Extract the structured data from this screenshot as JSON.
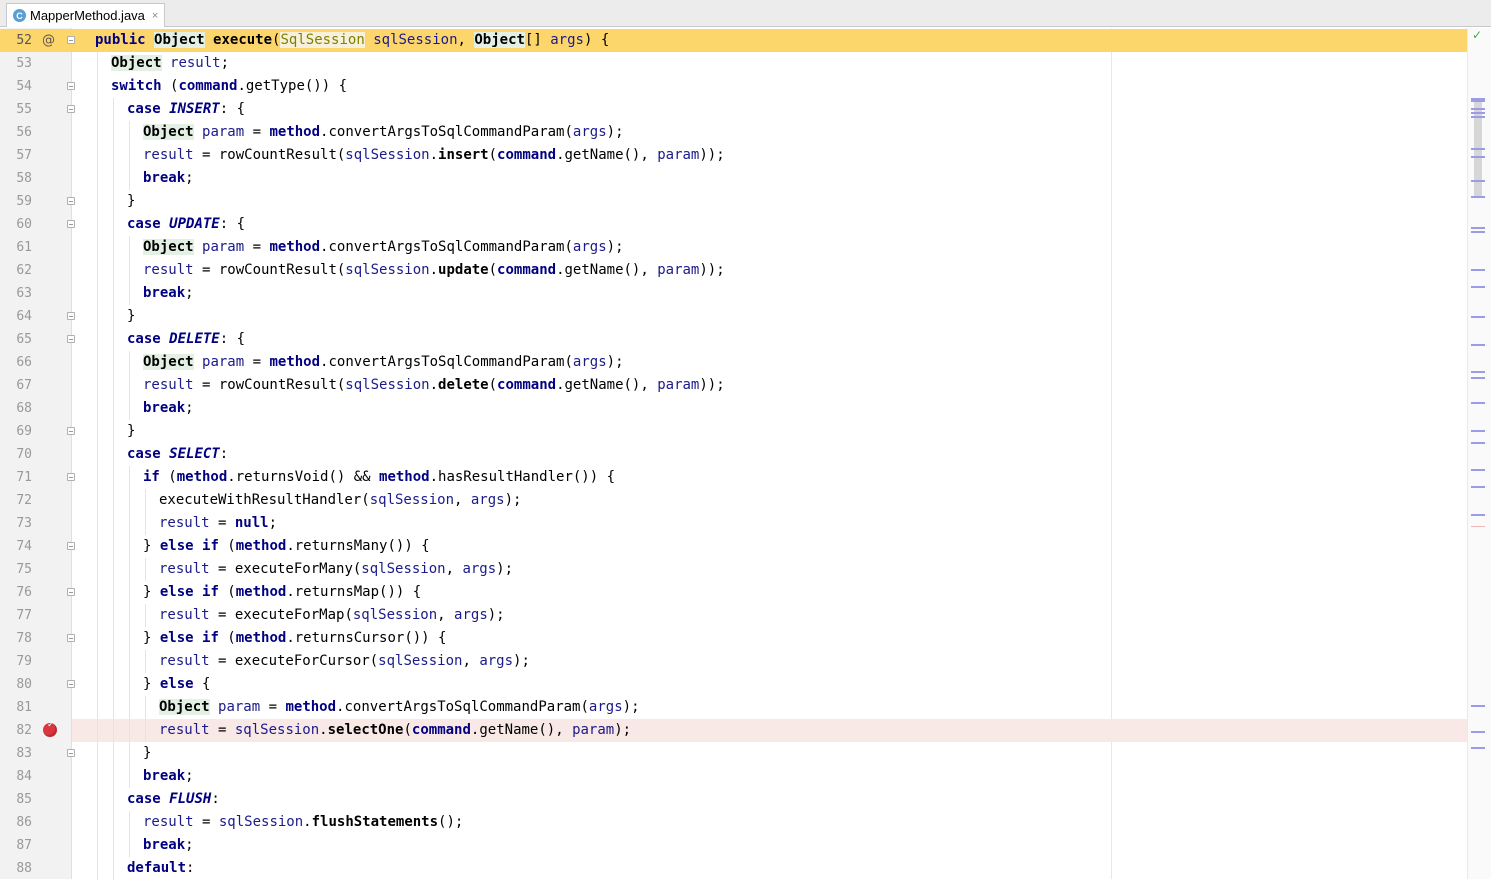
{
  "tab": {
    "file_name": "MapperMethod.java",
    "icon": "java-class-icon",
    "close": "×"
  },
  "scrollbar": {
    "status_icon": "check-icon",
    "status": "✓"
  },
  "gutter": {
    "override_icon": "@",
    "breakpoint_icon": "breakpoint-icon"
  },
  "editor": {
    "current_line": 52,
    "breakpoint_line": 82,
    "lines": [
      {
        "n": "52",
        "text": "public Object execute(SqlSession sqlSession, Object[] args) {"
      },
      {
        "n": "53",
        "text": "Object result;"
      },
      {
        "n": "54",
        "text": "switch (command.getType()) {"
      },
      {
        "n": "55",
        "text": "case INSERT: {"
      },
      {
        "n": "56",
        "text": "Object param = method.convertArgsToSqlCommandParam(args);"
      },
      {
        "n": "57",
        "text": "result = rowCountResult(sqlSession.insert(command.getName(), param));"
      },
      {
        "n": "58",
        "text": "break;"
      },
      {
        "n": "59",
        "text": "}"
      },
      {
        "n": "60",
        "text": "case UPDATE: {"
      },
      {
        "n": "61",
        "text": "Object param = method.convertArgsToSqlCommandParam(args);"
      },
      {
        "n": "62",
        "text": "result = rowCountResult(sqlSession.update(command.getName(), param));"
      },
      {
        "n": "63",
        "text": "break;"
      },
      {
        "n": "64",
        "text": "}"
      },
      {
        "n": "65",
        "text": "case DELETE: {"
      },
      {
        "n": "66",
        "text": "Object param = method.convertArgsToSqlCommandParam(args);"
      },
      {
        "n": "67",
        "text": "result = rowCountResult(sqlSession.delete(command.getName(), param));"
      },
      {
        "n": "68",
        "text": "break;"
      },
      {
        "n": "69",
        "text": "}"
      },
      {
        "n": "70",
        "text": "case SELECT:"
      },
      {
        "n": "71",
        "text": "if (method.returnsVoid() && method.hasResultHandler()) {"
      },
      {
        "n": "72",
        "text": "executeWithResultHandler(sqlSession, args);"
      },
      {
        "n": "73",
        "text": "result = null;"
      },
      {
        "n": "74",
        "text": "} else if (method.returnsMany()) {"
      },
      {
        "n": "75",
        "text": "result = executeForMany(sqlSession, args);"
      },
      {
        "n": "76",
        "text": "} else if (method.returnsMap()) {"
      },
      {
        "n": "77",
        "text": "result = executeForMap(sqlSession, args);"
      },
      {
        "n": "78",
        "text": "} else if (method.returnsCursor()) {"
      },
      {
        "n": "79",
        "text": "result = executeForCursor(sqlSession, args);"
      },
      {
        "n": "80",
        "text": "} else {"
      },
      {
        "n": "81",
        "text": "Object param = method.convertArgsToSqlCommandParam(args);"
      },
      {
        "n": "82",
        "text": "result = sqlSession.selectOne(command.getName(), param);"
      },
      {
        "n": "83",
        "text": "}"
      },
      {
        "n": "84",
        "text": "break;"
      },
      {
        "n": "85",
        "text": "case FLUSH:"
      },
      {
        "n": "86",
        "text": "result = sqlSession.flushStatements();"
      },
      {
        "n": "87",
        "text": "break;"
      },
      {
        "n": "88",
        "text": "default:"
      }
    ]
  },
  "colors": {
    "current_line_bg": "#fdd66b",
    "breakpoint_line_bg": "#f8e8e6",
    "keyword": "#000080",
    "field": "#660e7a",
    "breakpoint": "#d9363e"
  }
}
